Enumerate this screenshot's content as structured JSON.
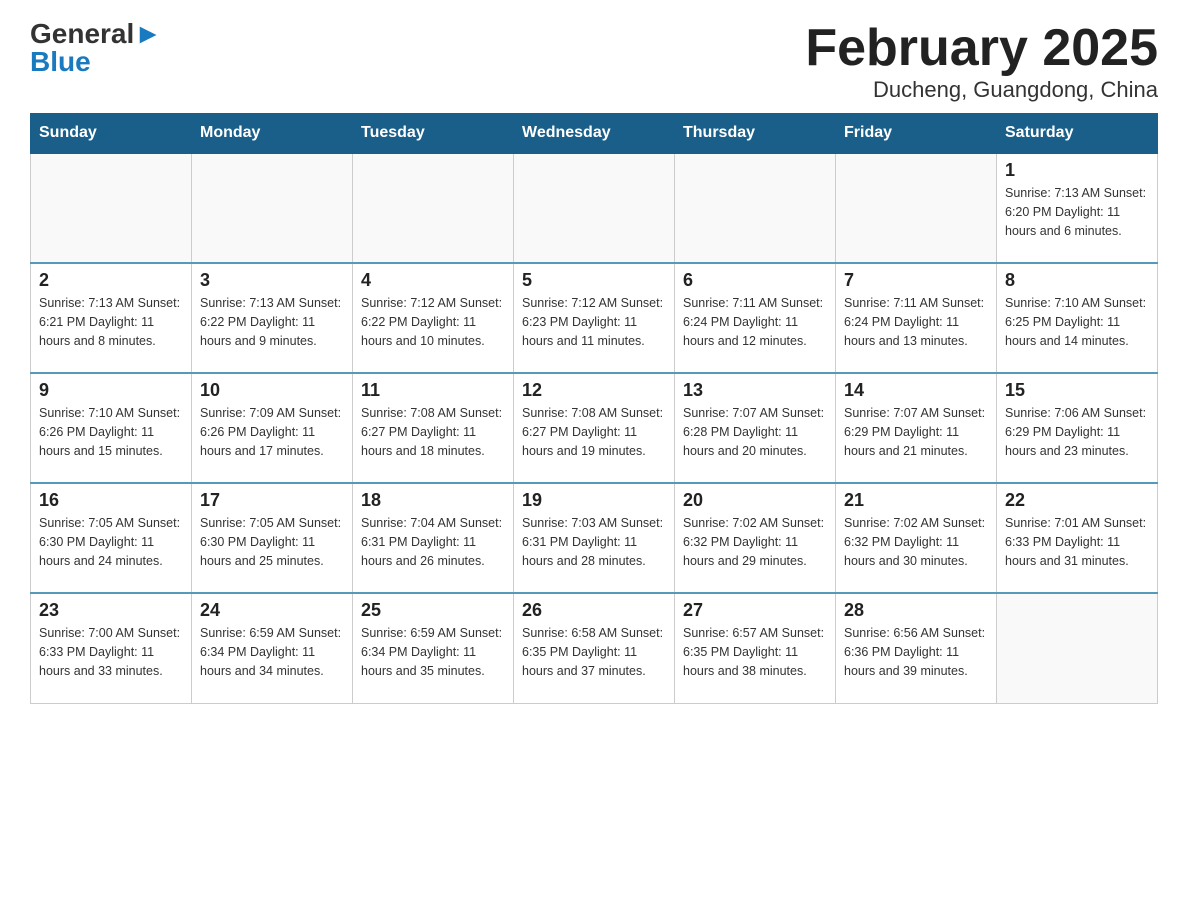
{
  "logo": {
    "general": "General",
    "blue": "Blue",
    "arrow": "▶"
  },
  "title": "February 2025",
  "subtitle": "Ducheng, Guangdong, China",
  "days_of_week": [
    "Sunday",
    "Monday",
    "Tuesday",
    "Wednesday",
    "Thursday",
    "Friday",
    "Saturday"
  ],
  "weeks": [
    [
      {
        "day": "",
        "info": ""
      },
      {
        "day": "",
        "info": ""
      },
      {
        "day": "",
        "info": ""
      },
      {
        "day": "",
        "info": ""
      },
      {
        "day": "",
        "info": ""
      },
      {
        "day": "",
        "info": ""
      },
      {
        "day": "1",
        "info": "Sunrise: 7:13 AM\nSunset: 6:20 PM\nDaylight: 11 hours and 6 minutes."
      }
    ],
    [
      {
        "day": "2",
        "info": "Sunrise: 7:13 AM\nSunset: 6:21 PM\nDaylight: 11 hours and 8 minutes."
      },
      {
        "day": "3",
        "info": "Sunrise: 7:13 AM\nSunset: 6:22 PM\nDaylight: 11 hours and 9 minutes."
      },
      {
        "day": "4",
        "info": "Sunrise: 7:12 AM\nSunset: 6:22 PM\nDaylight: 11 hours and 10 minutes."
      },
      {
        "day": "5",
        "info": "Sunrise: 7:12 AM\nSunset: 6:23 PM\nDaylight: 11 hours and 11 minutes."
      },
      {
        "day": "6",
        "info": "Sunrise: 7:11 AM\nSunset: 6:24 PM\nDaylight: 11 hours and 12 minutes."
      },
      {
        "day": "7",
        "info": "Sunrise: 7:11 AM\nSunset: 6:24 PM\nDaylight: 11 hours and 13 minutes."
      },
      {
        "day": "8",
        "info": "Sunrise: 7:10 AM\nSunset: 6:25 PM\nDaylight: 11 hours and 14 minutes."
      }
    ],
    [
      {
        "day": "9",
        "info": "Sunrise: 7:10 AM\nSunset: 6:26 PM\nDaylight: 11 hours and 15 minutes."
      },
      {
        "day": "10",
        "info": "Sunrise: 7:09 AM\nSunset: 6:26 PM\nDaylight: 11 hours and 17 minutes."
      },
      {
        "day": "11",
        "info": "Sunrise: 7:08 AM\nSunset: 6:27 PM\nDaylight: 11 hours and 18 minutes."
      },
      {
        "day": "12",
        "info": "Sunrise: 7:08 AM\nSunset: 6:27 PM\nDaylight: 11 hours and 19 minutes."
      },
      {
        "day": "13",
        "info": "Sunrise: 7:07 AM\nSunset: 6:28 PM\nDaylight: 11 hours and 20 minutes."
      },
      {
        "day": "14",
        "info": "Sunrise: 7:07 AM\nSunset: 6:29 PM\nDaylight: 11 hours and 21 minutes."
      },
      {
        "day": "15",
        "info": "Sunrise: 7:06 AM\nSunset: 6:29 PM\nDaylight: 11 hours and 23 minutes."
      }
    ],
    [
      {
        "day": "16",
        "info": "Sunrise: 7:05 AM\nSunset: 6:30 PM\nDaylight: 11 hours and 24 minutes."
      },
      {
        "day": "17",
        "info": "Sunrise: 7:05 AM\nSunset: 6:30 PM\nDaylight: 11 hours and 25 minutes."
      },
      {
        "day": "18",
        "info": "Sunrise: 7:04 AM\nSunset: 6:31 PM\nDaylight: 11 hours and 26 minutes."
      },
      {
        "day": "19",
        "info": "Sunrise: 7:03 AM\nSunset: 6:31 PM\nDaylight: 11 hours and 28 minutes."
      },
      {
        "day": "20",
        "info": "Sunrise: 7:02 AM\nSunset: 6:32 PM\nDaylight: 11 hours and 29 minutes."
      },
      {
        "day": "21",
        "info": "Sunrise: 7:02 AM\nSunset: 6:32 PM\nDaylight: 11 hours and 30 minutes."
      },
      {
        "day": "22",
        "info": "Sunrise: 7:01 AM\nSunset: 6:33 PM\nDaylight: 11 hours and 31 minutes."
      }
    ],
    [
      {
        "day": "23",
        "info": "Sunrise: 7:00 AM\nSunset: 6:33 PM\nDaylight: 11 hours and 33 minutes."
      },
      {
        "day": "24",
        "info": "Sunrise: 6:59 AM\nSunset: 6:34 PM\nDaylight: 11 hours and 34 minutes."
      },
      {
        "day": "25",
        "info": "Sunrise: 6:59 AM\nSunset: 6:34 PM\nDaylight: 11 hours and 35 minutes."
      },
      {
        "day": "26",
        "info": "Sunrise: 6:58 AM\nSunset: 6:35 PM\nDaylight: 11 hours and 37 minutes."
      },
      {
        "day": "27",
        "info": "Sunrise: 6:57 AM\nSunset: 6:35 PM\nDaylight: 11 hours and 38 minutes."
      },
      {
        "day": "28",
        "info": "Sunrise: 6:56 AM\nSunset: 6:36 PM\nDaylight: 11 hours and 39 minutes."
      },
      {
        "day": "",
        "info": ""
      }
    ]
  ]
}
